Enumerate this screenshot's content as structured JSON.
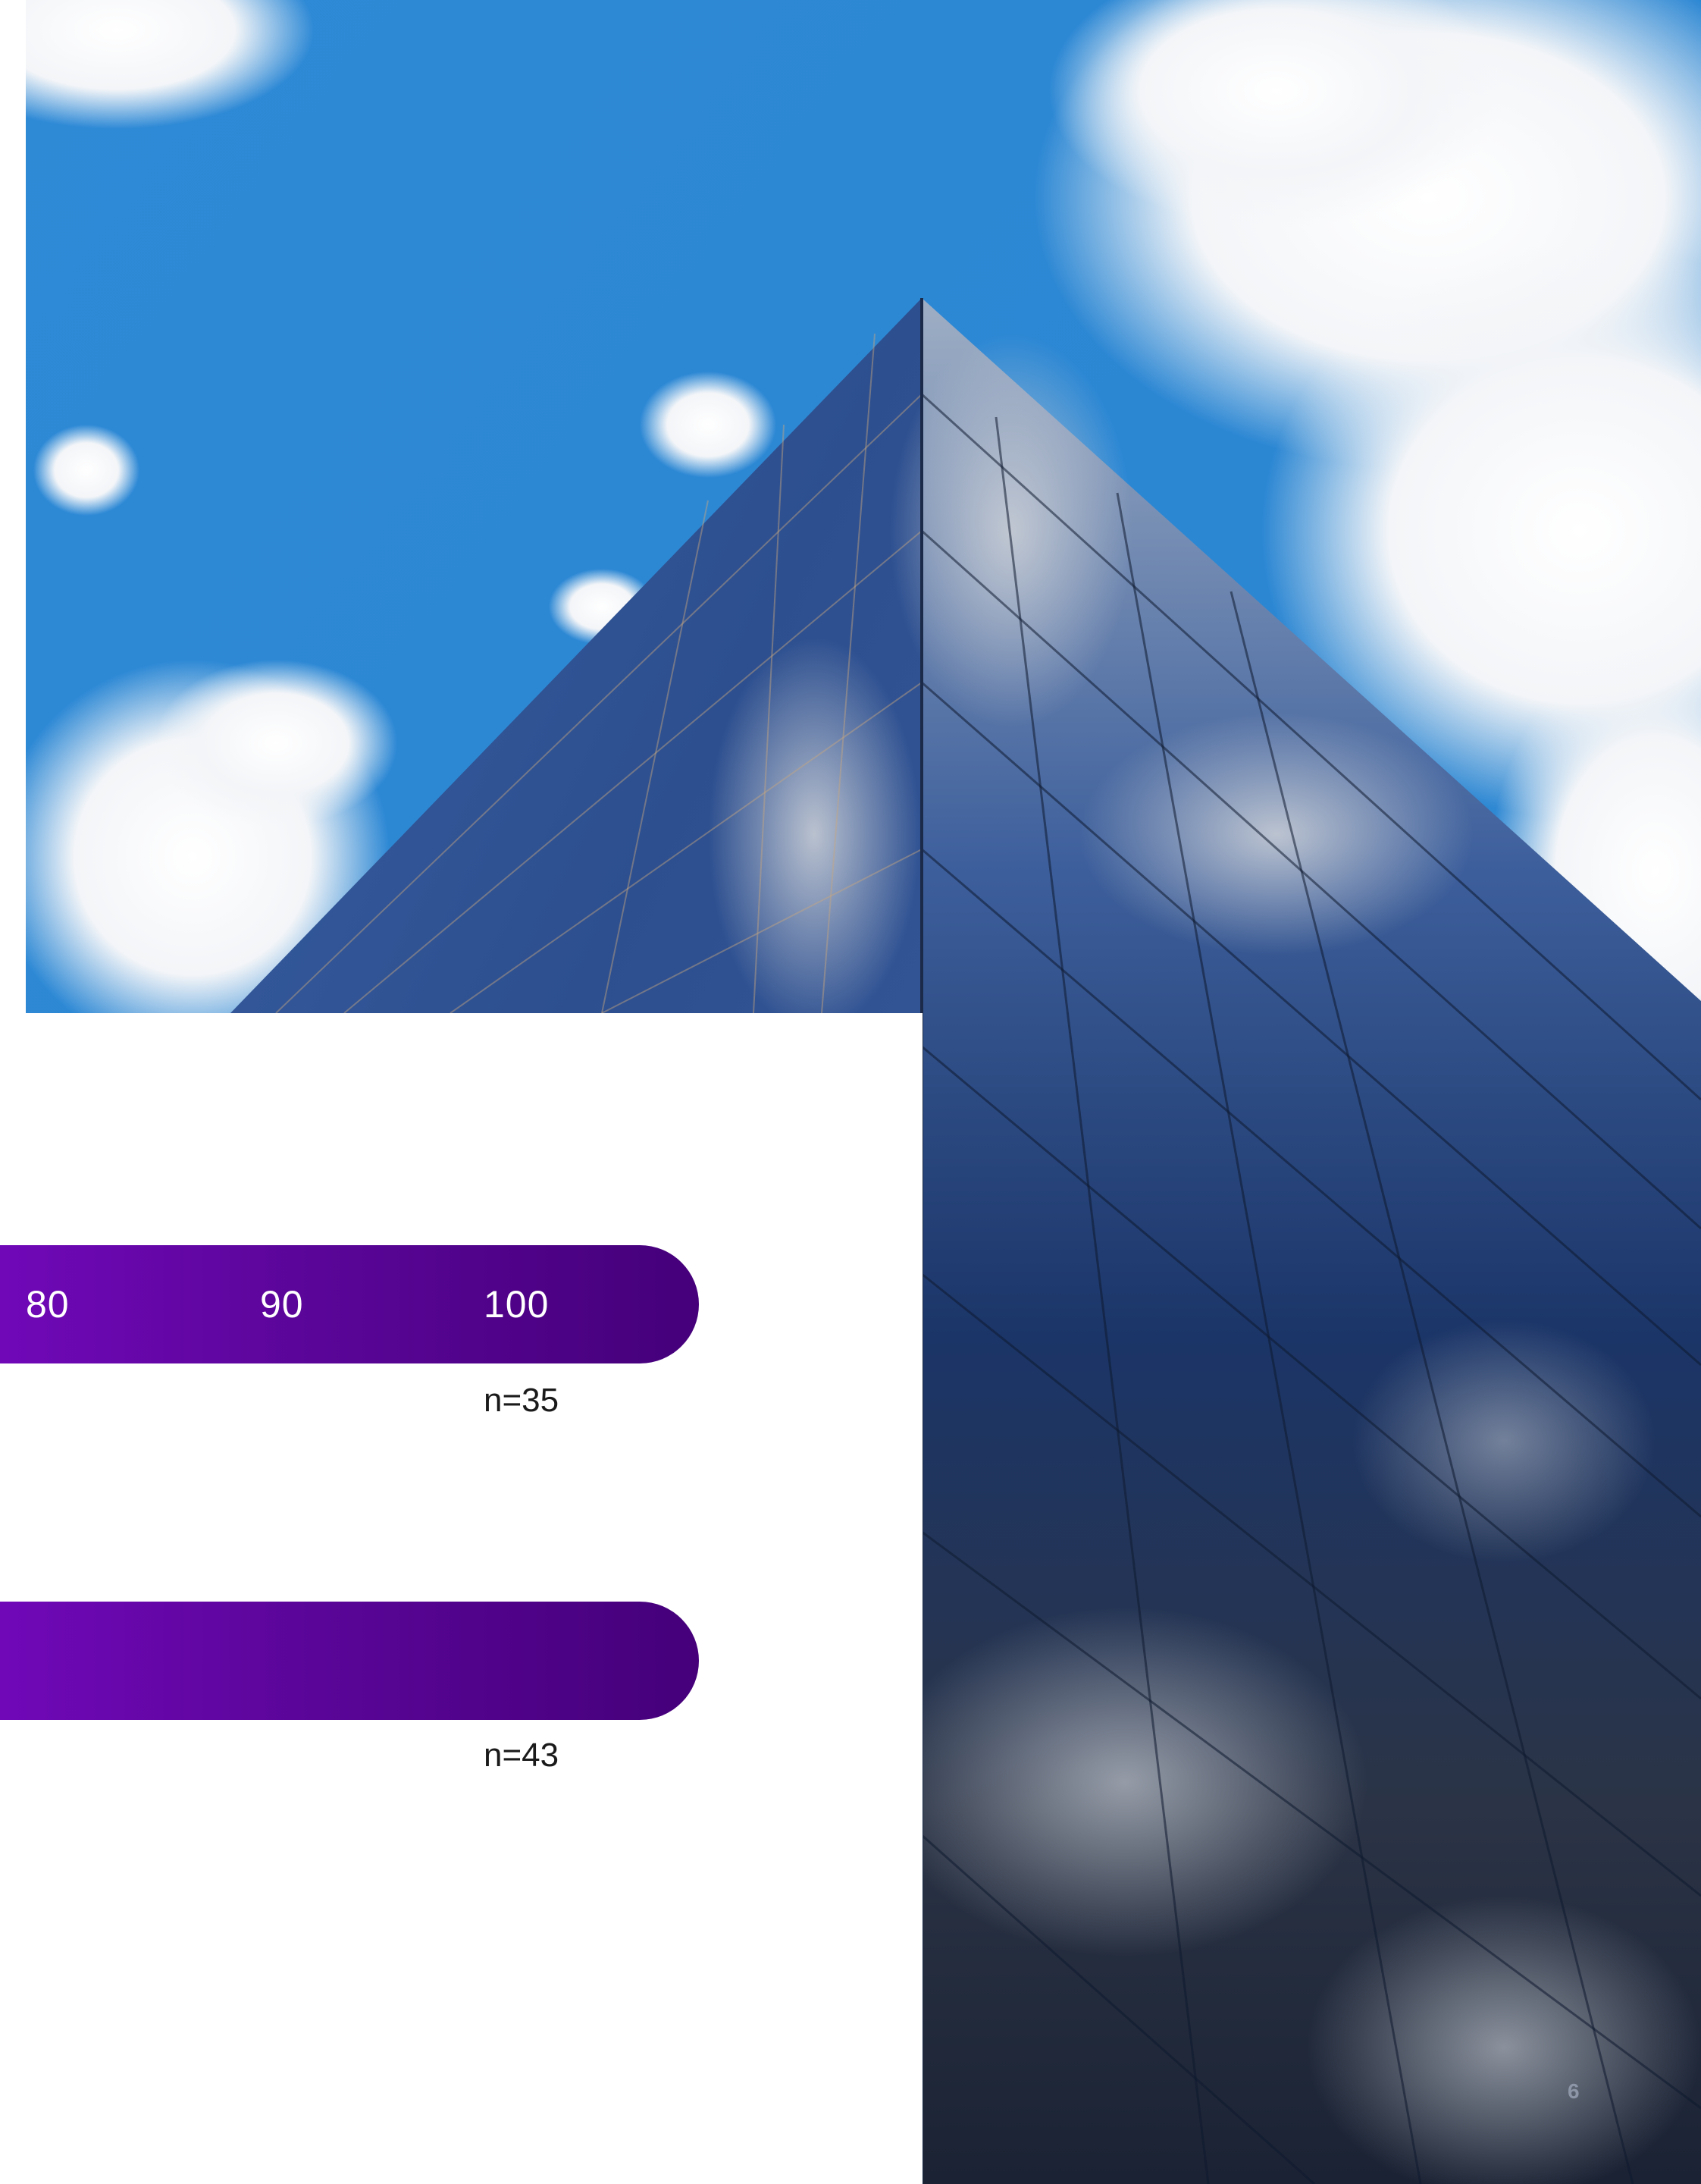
{
  "scale": {
    "tick_labels": [
      "80",
      "90",
      "100"
    ]
  },
  "bars": [
    {
      "sample_label": "n=35"
    },
    {
      "sample_label": "n=43"
    }
  ],
  "page": {
    "number": "6"
  },
  "colors": {
    "bar_start": "#7008b8",
    "bar_end": "#45007a",
    "sky": "#2d8ad4",
    "glass_dark": "#152a55"
  }
}
